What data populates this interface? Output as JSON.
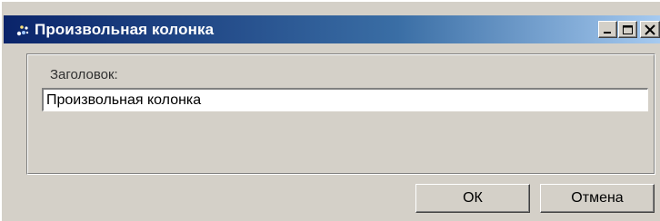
{
  "window": {
    "title": "Произвольная колонка",
    "controls": {
      "minimize_icon": "minimize-icon",
      "maximize_icon": "maximize-icon",
      "close_icon": "close-icon"
    },
    "colors": {
      "titlebar_start": "#0a246a",
      "titlebar_end": "#a6caf0",
      "face": "#d4d0c8"
    }
  },
  "form": {
    "header_label": "Заголовок:",
    "header_value": "Произвольная колонка"
  },
  "buttons": {
    "ok_label": "ОК",
    "cancel_label": "Отмена"
  }
}
